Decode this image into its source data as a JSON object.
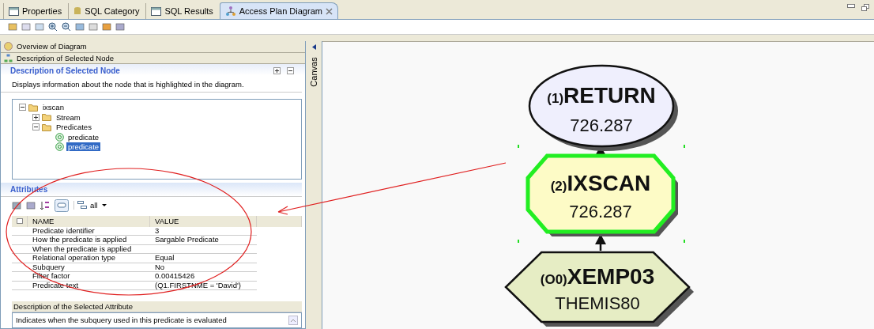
{
  "tabs": [
    {
      "label": "Properties",
      "kind": "table",
      "selected": false
    },
    {
      "label": "SQL Category",
      "kind": "db",
      "selected": false
    },
    {
      "label": "SQL Results",
      "kind": "table",
      "selected": false
    },
    {
      "label": "Access Plan Diagram",
      "kind": "diagram",
      "selected": true
    }
  ],
  "sections": [
    {
      "label": "Overview of Diagram",
      "kind": "overview"
    },
    {
      "label": "Description of Selected Node",
      "kind": "node"
    }
  ],
  "node_description": {
    "title": "Description of Selected Node",
    "text": "Displays information about the node that is highlighted in the diagram.",
    "tree": [
      {
        "label": "ixscan",
        "expanded": true,
        "selected": false,
        "children": [
          {
            "label": "Stream",
            "expanded": false,
            "selected": false
          },
          {
            "label": "Predicates",
            "expanded": true,
            "selected": false,
            "children": [
              {
                "label": "predicate",
                "selected": false
              },
              {
                "label": "predicate",
                "selected": true
              }
            ]
          }
        ]
      }
    ]
  },
  "attributes": {
    "title": "Attributes",
    "filter": "all",
    "columns": [
      "NAME",
      "VALUE"
    ],
    "rows": [
      [
        "Predicate identifier",
        "3"
      ],
      [
        "How the predicate is applied",
        "Sargable Predicate"
      ],
      [
        "When the predicate is applied",
        ""
      ],
      [
        "Relational operation type",
        "Equal"
      ],
      [
        "Subquery",
        "No"
      ],
      [
        "Filter factor",
        "0.00415426"
      ],
      [
        "Predicate text",
        "(Q1.FIRSTNME = 'David')"
      ]
    ]
  },
  "attribute_description": {
    "title": "Description of the Selected Attribute",
    "text": "Indicates when the subquery used in this predicate is evaluated"
  },
  "canvas": {
    "label": "Canvas",
    "nodes": [
      {
        "kind": "ellipse",
        "number": "(1)",
        "name": "RETURN",
        "value": "726.287",
        "selected": false
      },
      {
        "kind": "octagon",
        "number": "(2)",
        "name": "IXSCAN",
        "value": "726.287",
        "selected": true
      },
      {
        "kind": "hexagon",
        "number": "(O0)",
        "name": "XEMP03",
        "value": "THEMIS80",
        "selected": false
      }
    ]
  }
}
